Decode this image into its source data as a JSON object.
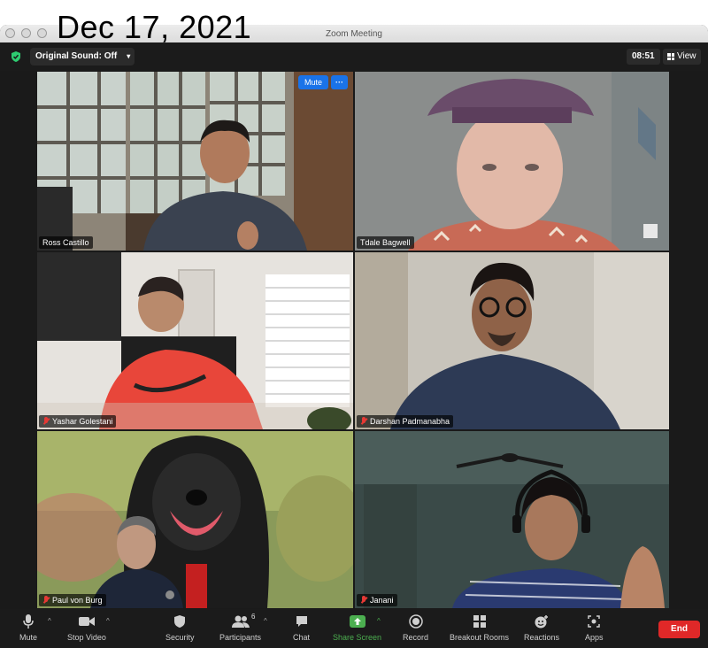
{
  "overlay": {
    "date": "Dec 17, 2021"
  },
  "window": {
    "title": "Zoom Meeting"
  },
  "topbar": {
    "original_sound": "Original Sound: Off",
    "timer": "08:51",
    "view_label": "View"
  },
  "active_tile": {
    "mute_label": "Mute",
    "more_label": "···"
  },
  "participants": [
    {
      "name": "Ross Castillo",
      "muted": false,
      "active_speaker": true
    },
    {
      "name": "Tdale Bagwell",
      "muted": false,
      "active_speaker": false
    },
    {
      "name": "Yashar Golestani",
      "muted": true,
      "active_speaker": false
    },
    {
      "name": "Darshan Padmanabha",
      "muted": true,
      "active_speaker": false
    },
    {
      "name": "Paul von Burg",
      "muted": true,
      "active_speaker": false
    },
    {
      "name": "Janani",
      "muted": true,
      "active_speaker": false
    }
  ],
  "toolbar": {
    "mute": "Mute",
    "stop_video": "Stop Video",
    "security": "Security",
    "participants": "Participants",
    "participants_count": "6",
    "chat": "Chat",
    "share_screen": "Share Screen",
    "record": "Record",
    "breakout_rooms": "Breakout Rooms",
    "reactions": "Reactions",
    "apps": "Apps",
    "end": "End"
  },
  "colors": {
    "active_border": "#d7e55a",
    "share_green": "#4caf50",
    "end_red": "#e02828",
    "mute_blue": "#1a73e8"
  }
}
